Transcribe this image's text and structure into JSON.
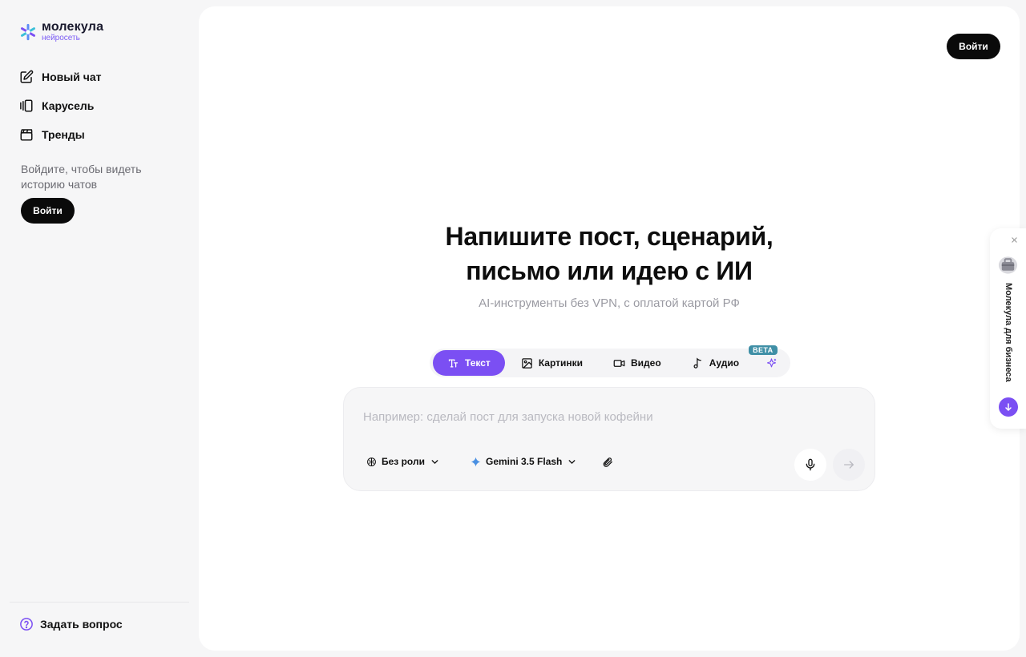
{
  "brand": {
    "name": "молекула",
    "subtitle": "нейросеть"
  },
  "sidebar": {
    "items": [
      {
        "label": "Новый чат",
        "icon": "edit-icon"
      },
      {
        "label": "Карусель",
        "icon": "carousel-icon"
      },
      {
        "label": "Тренды",
        "icon": "clapperboard-icon"
      }
    ],
    "login_hint": "Войдите, чтобы видеть историю чатов",
    "login_label": "Войти",
    "help_label": "Задать вопрос"
  },
  "header": {
    "login_label": "Войти"
  },
  "hero": {
    "title_line1": "Напишите пост, сценарий,",
    "title_line2": "письмо или идею с ИИ",
    "subtitle": "AI-инструменты без VPN, с оплатой картой РФ"
  },
  "tabs": [
    {
      "label": "Текст",
      "icon": "text-icon",
      "active": true
    },
    {
      "label": "Картинки",
      "icon": "image-icon",
      "active": false
    },
    {
      "label": "Видео",
      "icon": "video-icon",
      "active": false
    },
    {
      "label": "Аудио",
      "icon": "music-note-icon",
      "active": false
    }
  ],
  "magic_tab": {
    "badge": "BETA",
    "icon": "sparkles-icon"
  },
  "composer": {
    "placeholder": "Например: сделай пост для запуска новой кофейни",
    "role_label": "Без роли",
    "model_label": "Gemini 3.5 Flash"
  },
  "widget": {
    "label": "Молекула для бизнеса"
  },
  "colors": {
    "accent": "#7b4ff3",
    "dark": "#0a0a0a",
    "beta": "#3f8fa6"
  }
}
